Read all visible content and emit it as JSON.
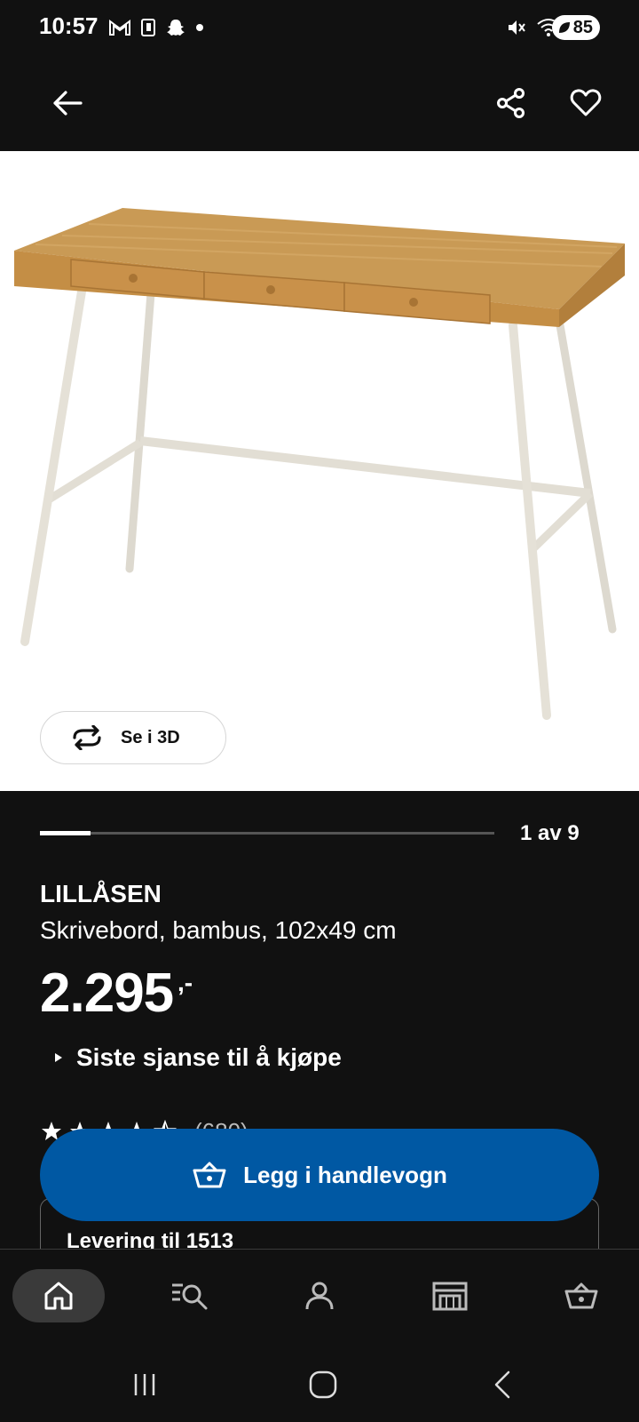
{
  "status_bar": {
    "time": "10:57",
    "battery": "85"
  },
  "app_bar": {
    "back_icon": "arrow-left-icon",
    "share_icon": "share-icon",
    "favorite_icon": "heart-icon"
  },
  "product_image": {
    "alt": "LILLÅSEN skrivebord i bambus med hvite ben",
    "view_3d_label": "Se i 3D"
  },
  "pager": {
    "text": "1 av 9",
    "current": 1,
    "total": 9
  },
  "product": {
    "name": "LILLÅSEN",
    "description": "Skrivebord, bambus, 102x49 cm",
    "price": "2.295",
    "price_suffix": ",-",
    "notice": "Siste sjanse til å kjøpe",
    "rating_count": "(680)",
    "rating_value": 4.5
  },
  "cart": {
    "add_label": "Legg i handlevogn"
  },
  "delivery": {
    "label": "Levering til 1513"
  },
  "bottom_nav": {
    "items": [
      {
        "name": "home",
        "icon": "home-icon",
        "active": true
      },
      {
        "name": "search",
        "icon": "search-list-icon",
        "active": false
      },
      {
        "name": "profile",
        "icon": "person-icon",
        "active": false
      },
      {
        "name": "stores",
        "icon": "store-icon",
        "active": false
      },
      {
        "name": "cart",
        "icon": "basket-icon",
        "active": false
      }
    ]
  },
  "colors": {
    "background": "#111111",
    "primary_button": "#0058a3",
    "text": "#ffffff"
  }
}
